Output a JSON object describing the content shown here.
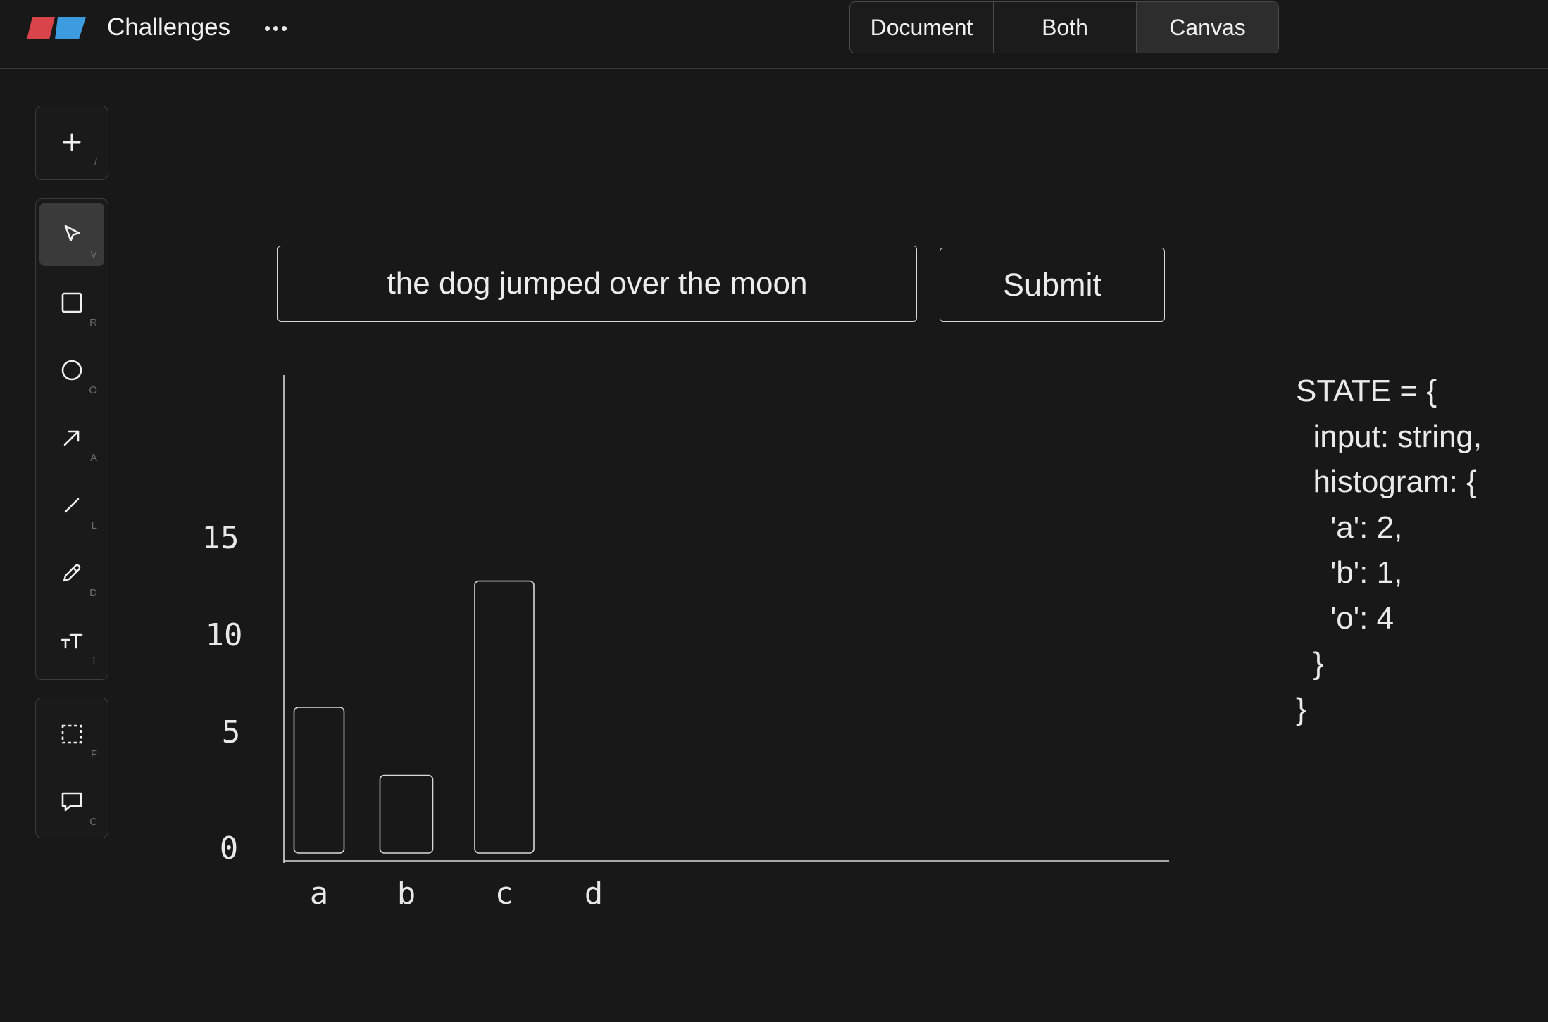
{
  "header": {
    "title": "Challenges",
    "view_modes": [
      "Document",
      "Both",
      "Canvas"
    ],
    "active_view": "Canvas"
  },
  "toolbar": {
    "add": {
      "icon": "plus-icon",
      "key": "/"
    },
    "tools": [
      {
        "name": "select",
        "icon": "cursor-arrow-icon",
        "key": "V",
        "active": true
      },
      {
        "name": "rectangle",
        "icon": "rectangle-icon",
        "key": "R"
      },
      {
        "name": "ellipse",
        "icon": "circle-icon",
        "key": "O"
      },
      {
        "name": "arrow",
        "icon": "arrow-icon",
        "key": "A"
      },
      {
        "name": "line",
        "icon": "line-icon",
        "key": "L"
      },
      {
        "name": "draw",
        "icon": "pencil-icon",
        "key": "D"
      },
      {
        "name": "text",
        "icon": "text-size-icon",
        "key": "T"
      }
    ],
    "extras": [
      {
        "name": "frame",
        "icon": "dashed-frame-icon",
        "key": "F"
      },
      {
        "name": "comment",
        "icon": "comment-icon",
        "key": "C"
      }
    ]
  },
  "canvas": {
    "input_text": "the dog jumped over the moon",
    "submit_label": "Submit",
    "state_code": "STATE = {\n  input: string,\n  histogram: {\n    'a': 2,\n    'b': 1,\n    'o': 4\n  }\n}"
  },
  "chart_data": {
    "type": "bar",
    "categories": [
      "a",
      "b",
      "c",
      "d"
    ],
    "values": [
      7.5,
      4,
      14,
      null
    ],
    "y_tick_labels": [
      "0",
      "5",
      "10",
      "15"
    ],
    "ylim": [
      0,
      16
    ],
    "grid": false,
    "title": "",
    "xlabel": "",
    "ylabel": ""
  },
  "colors": {
    "background": "#181818",
    "logo_red": "#d9444b",
    "logo_blue": "#3d9be0",
    "stroke": "#d8d8d8"
  }
}
